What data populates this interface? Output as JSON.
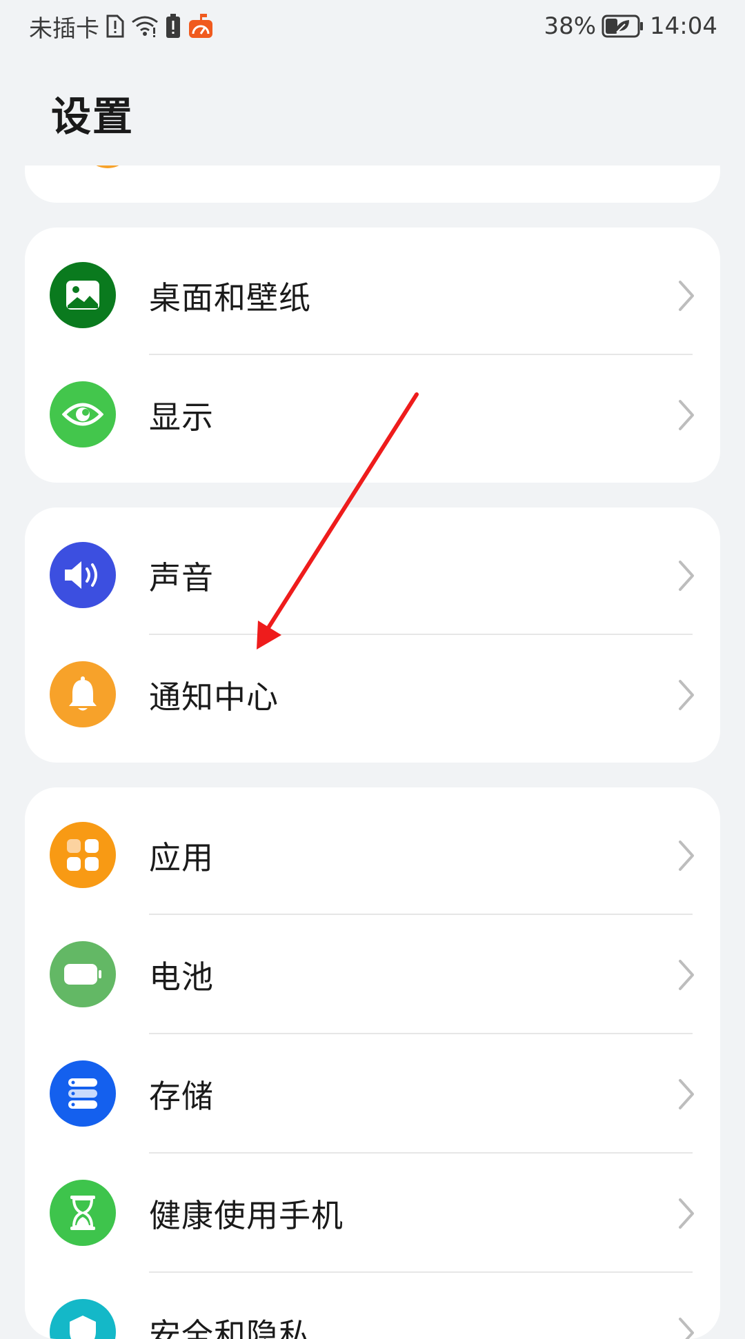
{
  "status_bar": {
    "carrier": "未插卡",
    "battery_percent": "38%",
    "time": "14:04"
  },
  "page": {
    "title": "设置"
  },
  "colors": {
    "desktop": "#0a7a1e",
    "display": "#43c64c",
    "sound": "#3c4fe0",
    "notification": "#f7a22a",
    "apps": "#f89a14",
    "battery": "#63b865",
    "storage": "#1460ee",
    "digital_balance": "#3ec44c",
    "security": "#14b8c8",
    "annotation_arrow": "#ee1c1c"
  },
  "groups": [
    {
      "items": [
        {
          "label": "桌面和壁纸",
          "icon": "wallpaper-icon"
        },
        {
          "label": "显示",
          "icon": "eye-icon"
        }
      ]
    },
    {
      "items": [
        {
          "label": "声音",
          "icon": "speaker-icon"
        },
        {
          "label": "通知中心",
          "icon": "bell-icon"
        }
      ]
    },
    {
      "items": [
        {
          "label": "应用",
          "icon": "apps-grid-icon"
        },
        {
          "label": "电池",
          "icon": "battery-icon"
        },
        {
          "label": "存储",
          "icon": "storage-icon"
        },
        {
          "label": "健康使用手机",
          "icon": "hourglass-icon"
        },
        {
          "label": "安全和隐私",
          "icon": "shield-icon"
        }
      ]
    }
  ]
}
